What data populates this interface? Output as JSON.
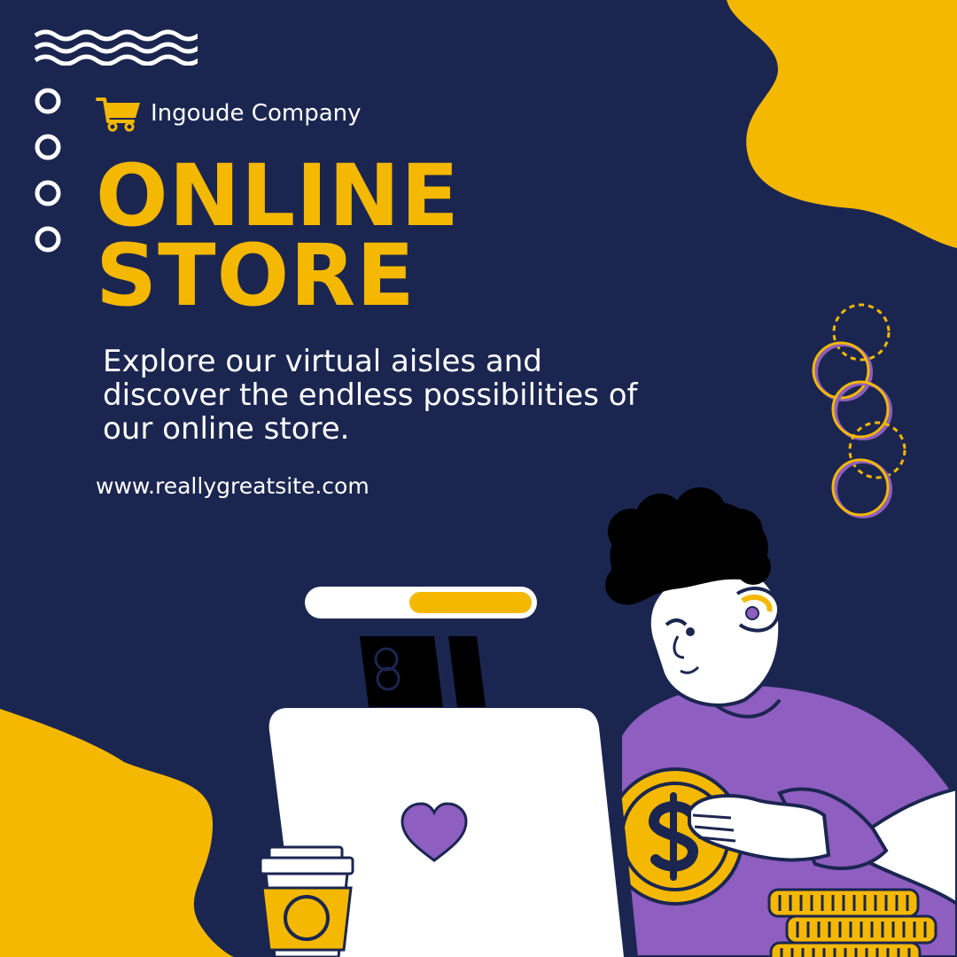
{
  "brand": {
    "name": "Ingoude Company",
    "icon": "shopping-cart-icon"
  },
  "headline": {
    "line1": "ONLINE",
    "line2": "STORE"
  },
  "tagline": "Explore our virtual aisles and discover the endless possibilities of our online store.",
  "website": "www.reallygreatsite.com",
  "progress": {
    "fraction": 0.55
  },
  "colors": {
    "background": "#1b2650",
    "accent_yellow": "#f5b800",
    "accent_purple": "#8e5ec0",
    "text": "#ffffff"
  },
  "icons": [
    "wave-lines-icon",
    "shopping-cart-icon",
    "heart-icon",
    "dollar-coin-icon",
    "coffee-cup-icon"
  ]
}
